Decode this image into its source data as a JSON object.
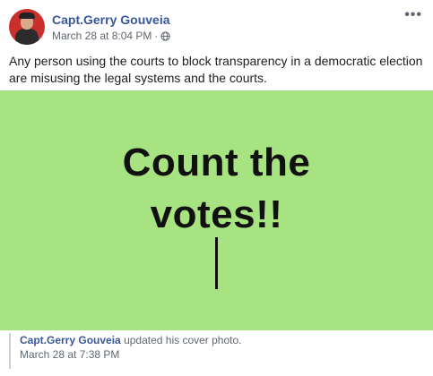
{
  "post": {
    "author": "Capt.Gerry Gouveia",
    "timestamp": "March 28 at 8:04 PM",
    "separator": "·",
    "privacy_icon": "globe-icon",
    "more_icon": "•••",
    "text": "Any person using the courts to block transparency in a democratic election are misusing the legal systems and the courts."
  },
  "cover": {
    "line1": "Count the",
    "line2": "votes!!",
    "background": "#a8e381"
  },
  "shared": {
    "author": "Capt.Gerry Gouveia",
    "action": "updated his cover photo.",
    "timestamp": "March 28 at 7:38 PM"
  }
}
